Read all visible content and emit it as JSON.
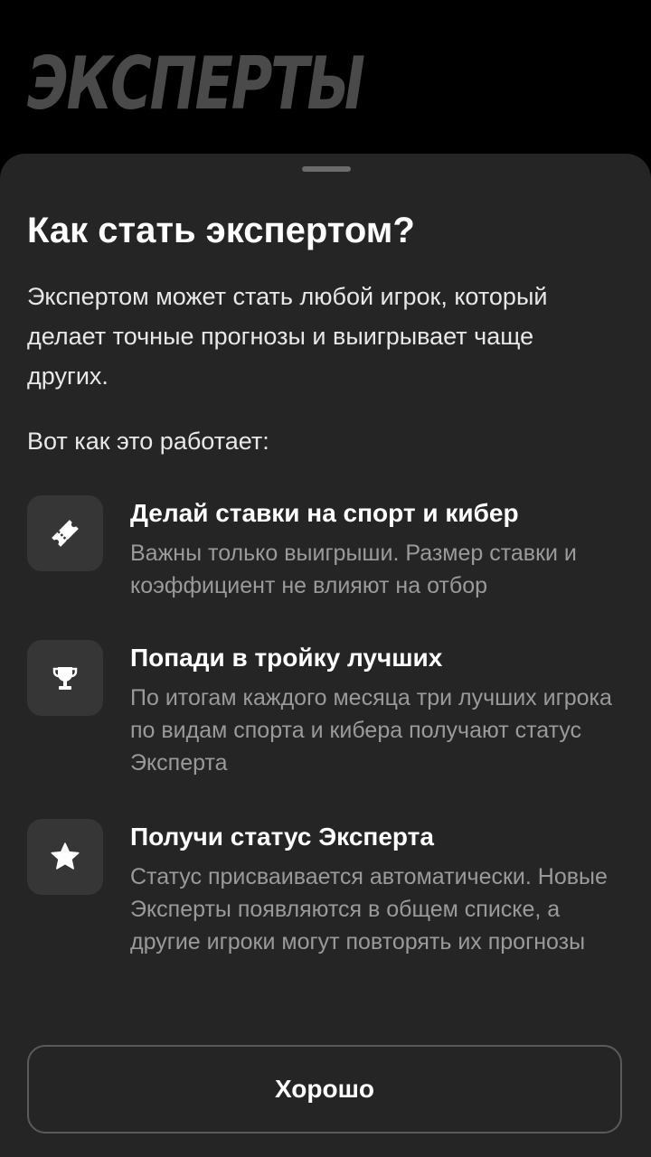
{
  "background": {
    "title": "ЭКСПЕРТЫ"
  },
  "sheet": {
    "title": "Как стать экспертом?",
    "intro": "Экспертом может стать любой игрок, который делает точные прогнозы и выигрывает чаще других.",
    "how_it_works": "Вот как это работает:",
    "steps": [
      {
        "icon": "ticket-icon",
        "title": "Делай ставки на спорт и кибер",
        "text": "Важны только выигрыши. Размер ставки и коэффициент не влияют на отбор"
      },
      {
        "icon": "trophy-icon",
        "title": "Попади в тройку лучших",
        "text": "По итогам каждого месяца три лучших игрока по видам спорта и кибера получают статус Эксперта"
      },
      {
        "icon": "star-icon",
        "title": "Получи статус Эксперта",
        "text": "Статус присваивается автоматически. Новые Эксперты появляются в общем списке, а другие игроки могут повторять их прогнозы"
      }
    ],
    "ok_button": "Хорошо"
  },
  "colors": {
    "page_background": "#000000",
    "sheet_background": "#252525",
    "icon_tile": "#363636",
    "primary_text": "#ffffff",
    "secondary_text": "#9a9a9a",
    "button_border": "#5a5a5a"
  }
}
